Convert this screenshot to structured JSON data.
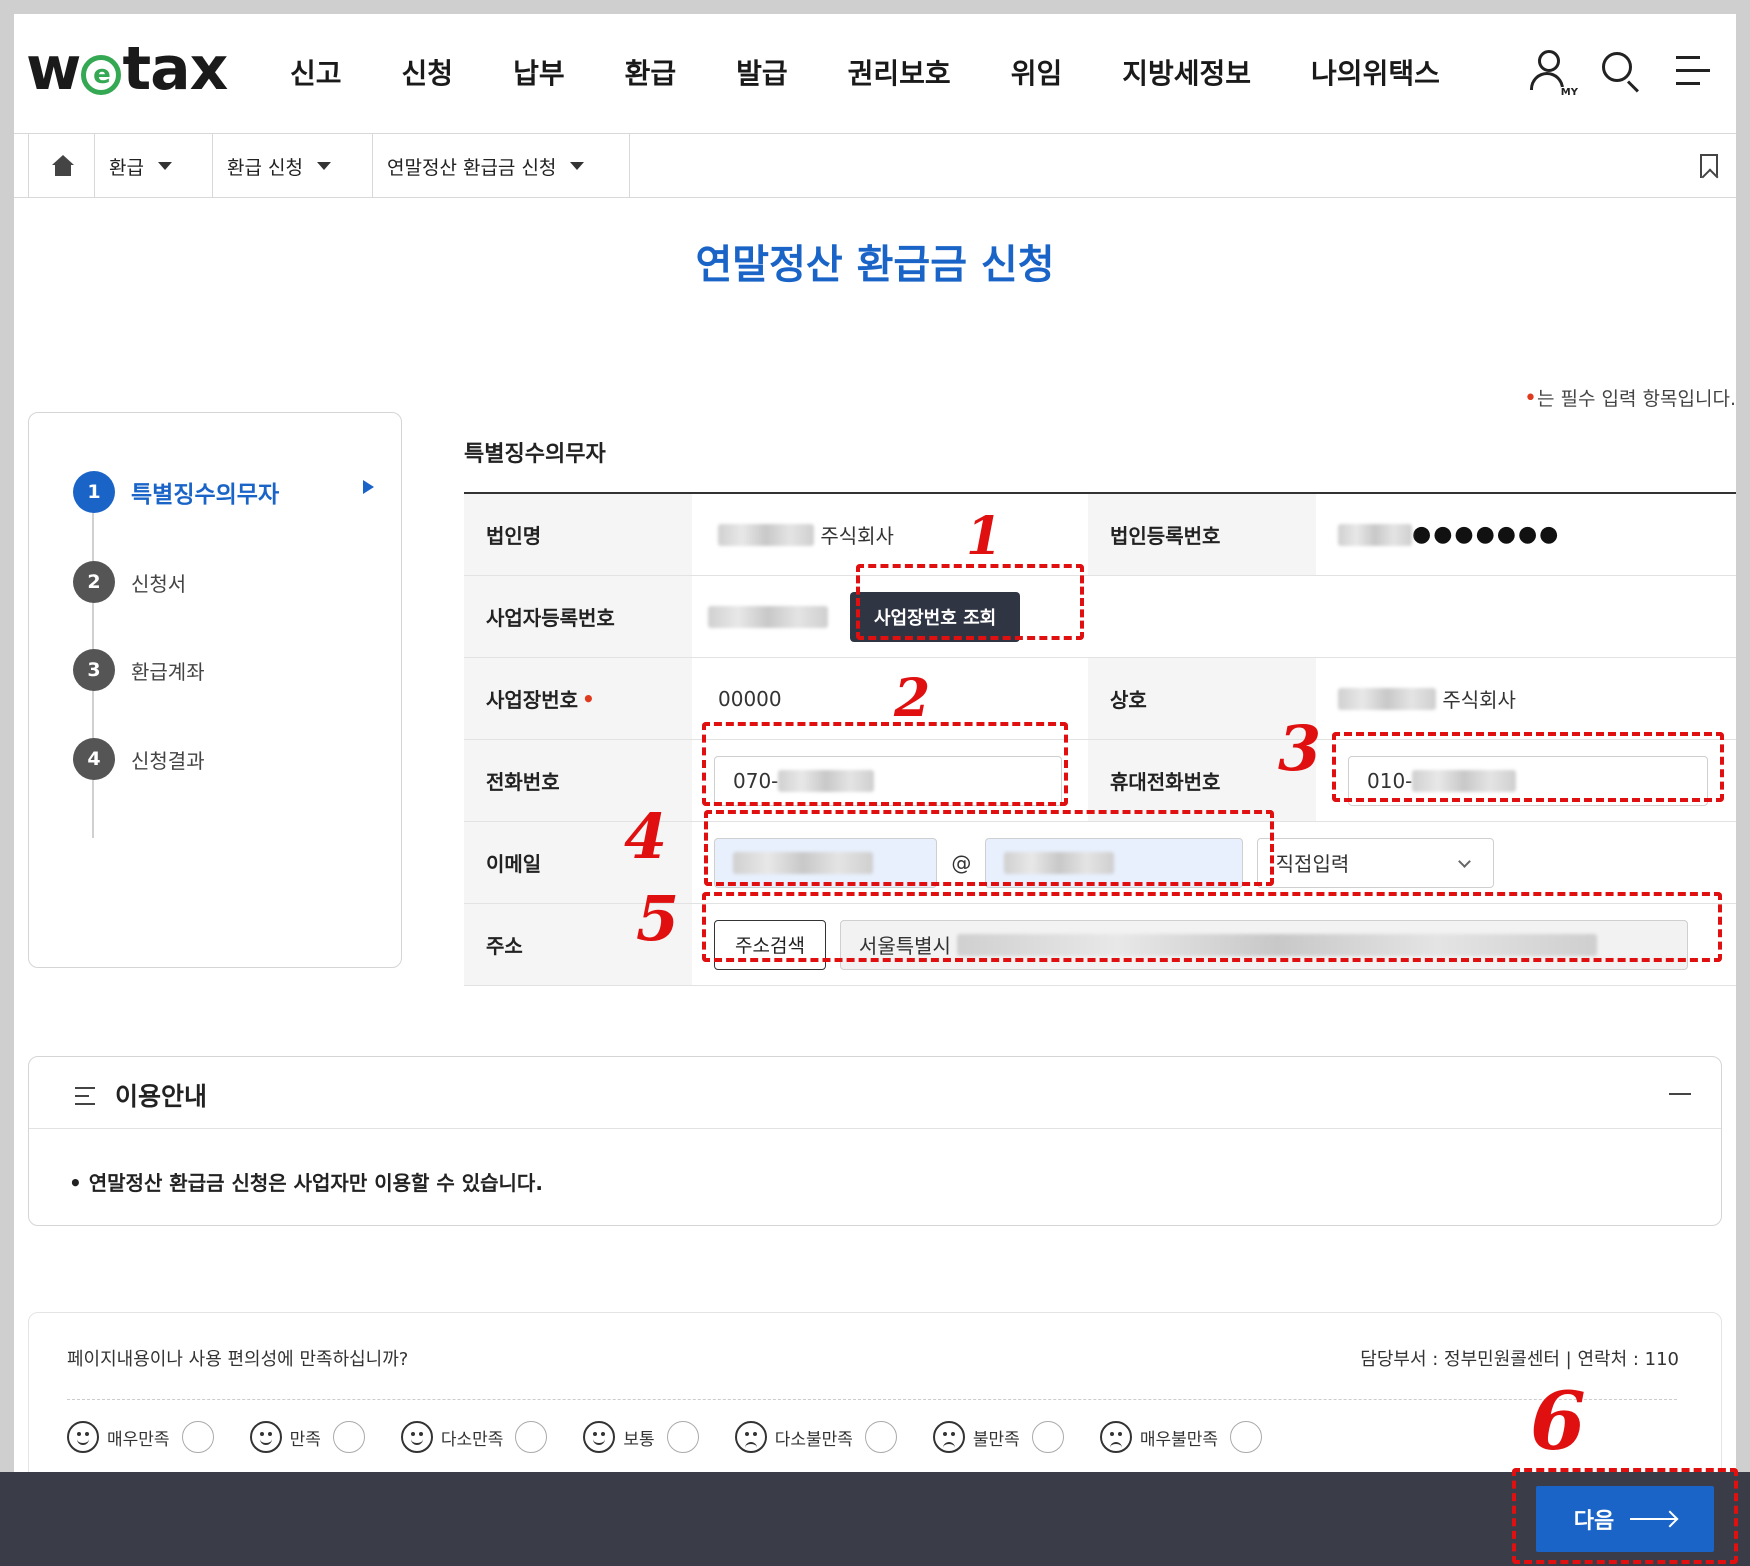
{
  "header": {
    "logo": "wetax",
    "nav": [
      "신고",
      "신청",
      "납부",
      "환급",
      "발급",
      "권리보호",
      "위임",
      "지방세정보",
      "나의위택스"
    ],
    "my_label": "MY"
  },
  "breadcrumb": [
    "환급",
    "환급 신청",
    "연말정산 환급금 신청"
  ],
  "page_title": "연말정산 환급금 신청",
  "required_note": "는 필수 입력 항목입니다.",
  "steps": [
    {
      "num": "1",
      "label": "특별징수의무자"
    },
    {
      "num": "2",
      "label": "신청서"
    },
    {
      "num": "3",
      "label": "환급계좌"
    },
    {
      "num": "4",
      "label": "신청결과"
    }
  ],
  "form": {
    "section_title": "특별징수의무자",
    "corp_name_label": "법인명",
    "corp_name_suffix": "주식회사",
    "corp_reg_label": "법인등록번호",
    "corp_reg_masked": "●●●●●●●",
    "biz_reg_label": "사업자등록번호",
    "biz_lookup_button": "사업장번호 조회",
    "workplace_label": "사업장번호",
    "workplace_value": "00000",
    "company_label": "상호",
    "company_suffix": "주식회사",
    "phone_label": "전화번호",
    "phone_prefix": "070-",
    "mobile_label": "휴대전화번호",
    "mobile_prefix": "010-",
    "email_label": "이메일",
    "email_at": "@",
    "email_domain_select": "직접입력",
    "address_label": "주소",
    "address_search_button": "주소검색",
    "address_prefix": "서울특별시"
  },
  "annotations": [
    "1",
    "2",
    "3",
    "4",
    "5",
    "6"
  ],
  "info": {
    "title": "이용안내",
    "text": "• 연말정산 환급금 신청은 사업자만 이용할 수 있습니다."
  },
  "survey": {
    "question": "페이지내용이나 사용 편의성에 만족하십니까?",
    "dept": "담당부서 : 정부민원콜센터   |   연락처 : 110",
    "options": [
      "매우만족",
      "만족",
      "다소만족",
      "보통",
      "다소불만족",
      "불만족",
      "매우불만족"
    ]
  },
  "next_button": "다음"
}
